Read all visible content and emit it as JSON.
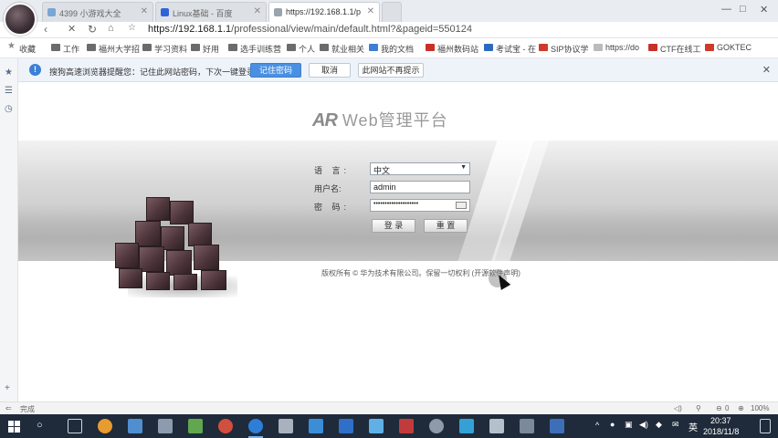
{
  "tabs": [
    {
      "label": "4399 小游戏大全",
      "active": false
    },
    {
      "label": "Linux基础 - 百度",
      "active": false
    },
    {
      "label": "https://192.168.1.1/p",
      "active": true
    }
  ],
  "address": {
    "host": "https://192.168.1.1",
    "path": "/professional/view/main/default.html?&pageid=550124"
  },
  "window_controls": {
    "min": "—",
    "max": "□",
    "close": "✕"
  },
  "bookmarks": [
    {
      "label": "收藏",
      "icon": "star-icon"
    },
    {
      "label": "工作",
      "icon": "folder-icon"
    },
    {
      "label": "福州大学招",
      "icon": "folder-icon"
    },
    {
      "label": "学习资料",
      "icon": "folder-icon"
    },
    {
      "label": "好用",
      "icon": "folder-icon"
    },
    {
      "label": "选手训练营",
      "icon": "folder-icon"
    },
    {
      "label": "个人",
      "icon": "folder-icon"
    },
    {
      "label": "就业相关",
      "icon": "folder-icon"
    },
    {
      "label": "我的文档",
      "icon": "grid-icon"
    },
    {
      "label": "福州数码站",
      "icon": "site-icon"
    },
    {
      "label": "考试宝 - 在",
      "icon": "site-icon"
    },
    {
      "label": "SIP协议学",
      "icon": "site-icon"
    },
    {
      "label": "https://do",
      "icon": "page-icon"
    },
    {
      "label": "CTF在线工",
      "icon": "site-icon"
    },
    {
      "label": "GOKTEC",
      "icon": "site-icon"
    }
  ],
  "notification": {
    "message": "搜狗高速浏览器提醒您：记住此网站密码，下次一键登录！",
    "primary_label": "记住密码",
    "cancel_label": "取消",
    "never_label": "此网站不再提示"
  },
  "login": {
    "logo_mark": "AR",
    "logo_text": "Web管理平台",
    "language_label": "语 言:",
    "language_value": "中文",
    "username_label": "用户名:",
    "username_value": "admin",
    "password_label": "密 码:",
    "password_value": "••••••••••••••••••••",
    "login_button": "登 录",
    "reset_button": "重 置",
    "copyright": "版权所有 © 华为技术有限公司。保留一切权利 (开源软件声明)"
  },
  "statusbar": {
    "left_text": "完成",
    "zoom": "100%",
    "download_count": "0"
  },
  "taskbar": {
    "ime": "英",
    "time": "20:37",
    "date": "2018/11/8"
  }
}
